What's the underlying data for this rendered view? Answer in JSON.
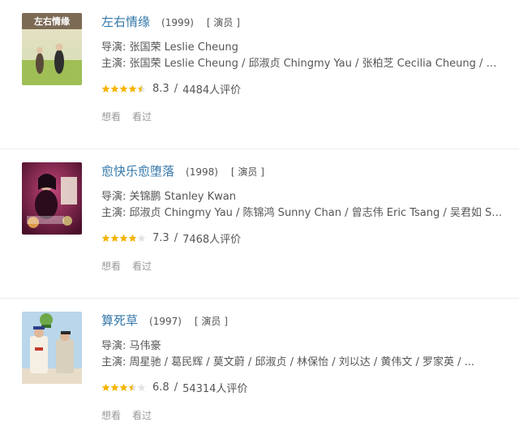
{
  "movies": [
    {
      "title": "左右情缘",
      "year": "(1999)",
      "role": "[ 演员 ]",
      "director": "导演: 张国荣 Leslie Cheung",
      "cast": "主演: 张国荣 Leslie Cheung / 邱淑贞 Chingmy Yau / 张柏芝 Cecilia Cheung / 梅艳...",
      "stars": 4.5,
      "score": "8.3",
      "sep": "/",
      "votes": "4484人评价",
      "want": "想看",
      "seen": "看过",
      "poster_text": "左右情缘"
    },
    {
      "title": "愈快乐愈堕落",
      "year": "(1998)",
      "role": "[ 演员 ]",
      "director": "导演: 关锦鹏 Stanley Kwan",
      "cast": "主演: 邱淑贞 Chingmy Yau / 陈锦鸿 Sunny Chan / 曾志伟 Eric Tsang / 吴君如 Sand...",
      "stars": 4,
      "score": "7.3",
      "sep": "/",
      "votes": "7468人评价",
      "want": "想看",
      "seen": "看过",
      "poster_text": ""
    },
    {
      "title": "算死草",
      "year": "(1997)",
      "role": "[ 演员 ]",
      "director": "导演: 马伟豪",
      "cast": "主演: 周星驰 / 葛民辉 / 莫文蔚 / 邱淑贞 / 林保怡 / 刘以达 / 黄伟文 / 罗家英 / ...",
      "stars": 3.5,
      "score": "6.8",
      "sep": "/",
      "votes": "54314人评价",
      "want": "想看",
      "seen": "看过",
      "poster_text": ""
    }
  ],
  "colors": {
    "link": "#3377aa",
    "star": "#f5b400",
    "star_empty": "#e3e3e3"
  }
}
